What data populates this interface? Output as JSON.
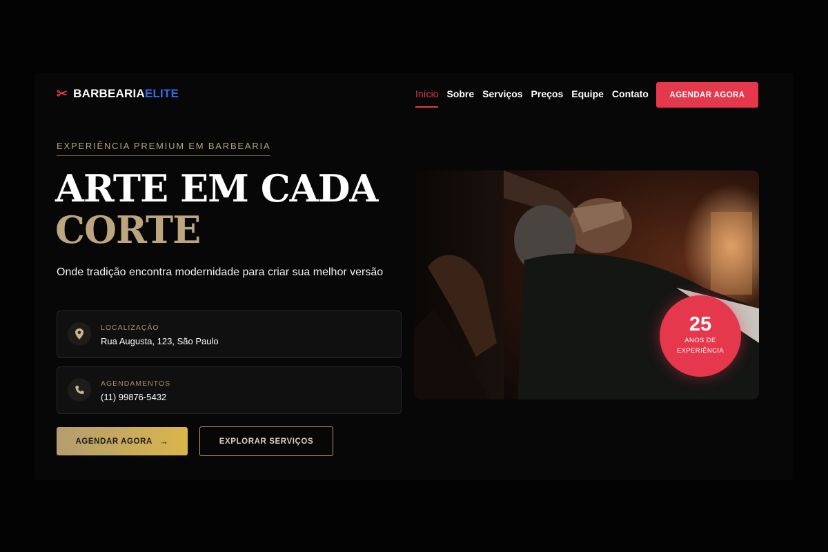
{
  "header": {
    "logo_brand": "BARBEARIA",
    "logo_accent": "ELITE",
    "logo_icon": "scissors-icon",
    "nav": [
      {
        "label": "Início",
        "active": true
      },
      {
        "label": "Sobre"
      },
      {
        "label": "Serviços"
      },
      {
        "label": "Preços"
      },
      {
        "label": "Equipe"
      },
      {
        "label": "Contato"
      }
    ],
    "cta_label": "AGENDAR AGORA"
  },
  "hero": {
    "eyebrow": "EXPERIÊNCIA PREMIUM EM BARBEARIA",
    "title_line1": "ARTE EM CADA",
    "title_line2": "CORTE",
    "subtitle": "Onde tradição encontra modernidade para criar sua melhor versão",
    "info_cards": [
      {
        "icon": "location-pin-icon",
        "label": "LOCALIZAÇÃO",
        "value": "Rua Augusta, 123, São Paulo"
      },
      {
        "icon": "phone-icon",
        "label": "AGENDAMENTOS",
        "value": "(11) 99876-5432"
      }
    ],
    "primary_button": "AGENDAR AGORA",
    "primary_button_icon": "arrow-right-icon",
    "secondary_button": "EXPLORAR SERVIÇOS"
  },
  "badge": {
    "number": "25",
    "line1": "ANOS DE",
    "line2": "EXPERIÊNCIA"
  },
  "colors": {
    "accent_red": "#e5384c",
    "accent_blue": "#2f6df0",
    "gold": "#bca57f",
    "background": "#070707"
  }
}
